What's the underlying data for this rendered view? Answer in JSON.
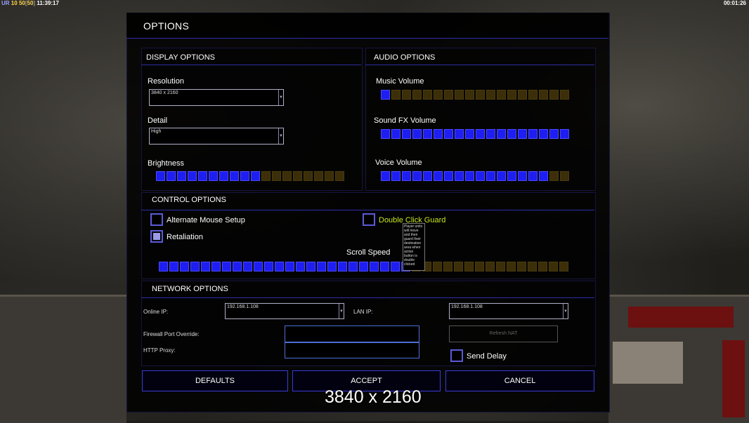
{
  "hud": {
    "topleft": {
      "a": "UR",
      "b": "10",
      "c": "50",
      "d": "[",
      "e": "50",
      "f": "]",
      "time": "11:39:17"
    },
    "topright": "00:01:26"
  },
  "colors": {
    "accent": "#2e2ea6",
    "bar_on": "#1e1ef2",
    "bar_off": "#3b2e08",
    "highlight": "#c8e61e"
  },
  "dialog": {
    "title": "OPTIONS"
  },
  "display": {
    "title": "DISPLAY OPTIONS",
    "resolution_label": "Resolution",
    "resolution_value": "3840 x 2160",
    "detail_label": "Detail",
    "detail_value": "High",
    "brightness_label": "Brightness",
    "brightness_level": {
      "on": 10,
      "total": 18
    }
  },
  "audio": {
    "title": "AUDIO OPTIONS",
    "music_label": "Music Volume",
    "music_level": {
      "on": 1,
      "total": 18
    },
    "sfx_label": "Sound FX Volume",
    "sfx_level": {
      "on": 18,
      "total": 18
    },
    "voice_label": "Voice Volume",
    "voice_level": {
      "on": 16,
      "total": 18
    }
  },
  "control": {
    "title": "CONTROL OPTIONS",
    "alt_mouse_label": "Alternate Mouse Setup",
    "alt_mouse_checked": false,
    "retaliation_label": "Retaliation",
    "retaliation_checked": true,
    "double_click_label": "Double Click Guard",
    "double_click_checked": false,
    "tooltip": "Player units will move and then guard their destination area when action button is double clicked",
    "scroll_label": "Scroll Speed",
    "scroll_level": {
      "on": 24,
      "total": 39
    }
  },
  "network": {
    "title": "NETWORK OPTIONS",
    "online_ip_label": "Online IP:",
    "online_ip_value": "192.168.1.108",
    "lan_ip_label": "LAN IP:",
    "lan_ip_value": "192.168.1.108",
    "firewall_label": "Firewall Port Override:",
    "firewall_value": "",
    "proxy_label": "HTTP Proxy:",
    "proxy_value": "",
    "refresh_nat_label": "Refresh NAT",
    "send_delay_label": "Send Delay",
    "send_delay_checked": false
  },
  "buttons": {
    "defaults": "DEFAULTS",
    "accept": "ACCEPT",
    "cancel": "CANCEL"
  },
  "overlay_resolution": "3840 x 2160"
}
